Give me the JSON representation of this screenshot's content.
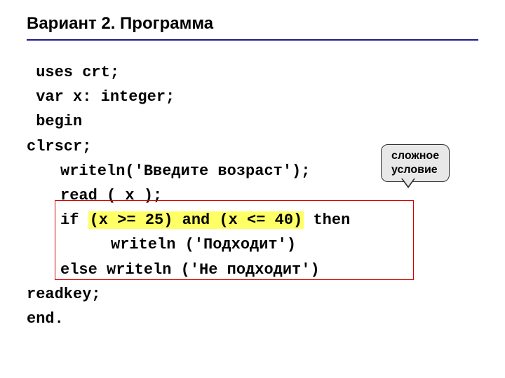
{
  "title": "Вариант 2. Программа",
  "code": {
    "l1": " uses crt;",
    "l2": " var x: integer;",
    "l3": " begin",
    "l4": "clrscr;",
    "l5": "writeln('Введите возраст');",
    "l6": "read ( x );",
    "l7a": "if ",
    "l7b": "(x >= 25) and (x <= 40)",
    "l7c": " then",
    "l8": "writeln ('Подходит')",
    "l9": "else writeln ('Не подходит')",
    "l10": "readkey;",
    "l11": "end."
  },
  "callout_label": "сложное\nусловие"
}
